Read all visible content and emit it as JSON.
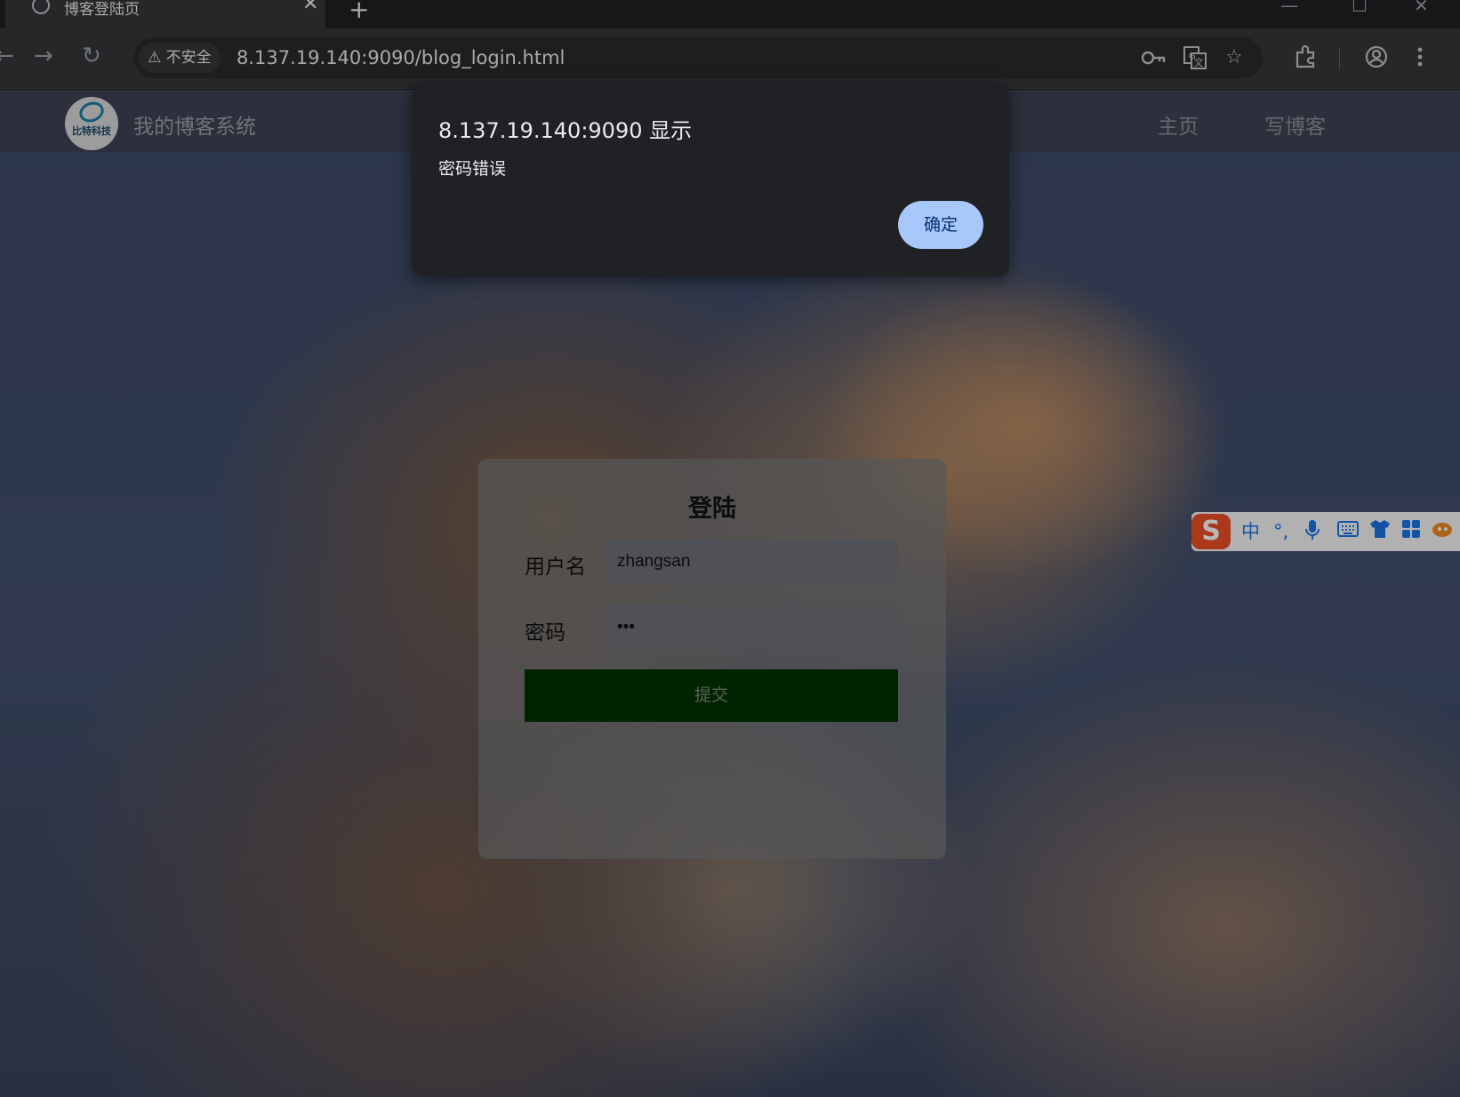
{
  "browser": {
    "tab": {
      "title": "博客登陆页",
      "close_glyph": "✕",
      "favicon": "globe-icon"
    },
    "new_tab_glyph": "+",
    "window_controls": {
      "minimize": "—",
      "maximize": "☐",
      "close": "✕"
    },
    "nav": {
      "back": "←",
      "forward": "→",
      "reload": "↻"
    },
    "security_label": "不安全",
    "security_glyph": "⚠",
    "url": "8.137.19.140:9090/blog_login.html",
    "omnibox_icons": [
      "key-icon",
      "translate-icon",
      "star-icon"
    ],
    "toolbar_icons": [
      "extensions-icon",
      "profile-icon",
      "menu-icon"
    ]
  },
  "blog": {
    "logo_text": "比特科技",
    "site_title": "我的博客系统",
    "nav_links": [
      "主页",
      "写博客"
    ]
  },
  "login": {
    "title": "登陆",
    "username_label": "用户名",
    "username_value": "zhangsan",
    "password_label": "密码",
    "password_value": "•••",
    "submit_label": "提交"
  },
  "ime": {
    "logo": "S",
    "items": [
      "中",
      "°,",
      "mic-icon",
      "keyboard-icon",
      "skin-icon",
      "toolbox-icon",
      "mascot-icon"
    ],
    "mode_label": "中",
    "punct_label": "°,"
  },
  "dialog": {
    "title": "8.137.19.140:9090 显示",
    "message": "密码错误",
    "ok_label": "确定"
  },
  "colors": {
    "dialog_bg": "#202124",
    "ok_button": "#a8c7fa",
    "submit_button": "#003300",
    "ime_logo": "#ee4e25"
  }
}
